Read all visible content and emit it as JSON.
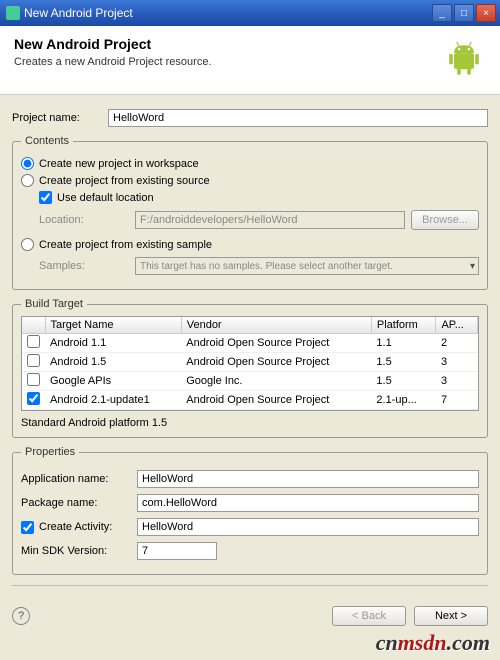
{
  "window": {
    "title": "New Android Project"
  },
  "header": {
    "title": "New Android Project",
    "subtitle": "Creates a new Android Project resource."
  },
  "projectName": {
    "label": "Project name:",
    "value": "HelloWord"
  },
  "contents": {
    "legend": "Contents",
    "createNew": "Create new project in workspace",
    "fromSource": "Create project from existing source",
    "useDefault": "Use default location",
    "locationLabel": "Location:",
    "locationValue": "F:/androiddevelopers/HelloWord",
    "browse": "Browse...",
    "fromSample": "Create project from existing sample",
    "samplesLabel": "Samples:",
    "samplesPlaceholder": "This target has no samples. Please select another target."
  },
  "buildTarget": {
    "legend": "Build Target",
    "cols": {
      "name": "Target Name",
      "vendor": "Vendor",
      "platform": "Platform",
      "api": "AP..."
    },
    "rows": [
      {
        "checked": false,
        "name": "Android 1.1",
        "vendor": "Android Open Source Project",
        "platform": "1.1",
        "api": "2"
      },
      {
        "checked": false,
        "name": "Android 1.5",
        "vendor": "Android Open Source Project",
        "platform": "1.5",
        "api": "3"
      },
      {
        "checked": false,
        "name": "Google APIs",
        "vendor": "Google Inc.",
        "platform": "1.5",
        "api": "3"
      },
      {
        "checked": true,
        "name": "Android 2.1-update1",
        "vendor": "Android Open Source Project",
        "platform": "2.1-up...",
        "api": "7"
      }
    ],
    "note": "Standard Android platform 1.5"
  },
  "properties": {
    "legend": "Properties",
    "appNameLabel": "Application name:",
    "appNameValue": "HelloWord",
    "pkgLabel": "Package name:",
    "pkgValue": "com.HelloWord",
    "activityLabel": "Create Activity:",
    "activityValue": "HelloWord",
    "minSdkLabel": "Min SDK Version:",
    "minSdkValue": "7"
  },
  "footer": {
    "back": "< Back",
    "next": "Next >"
  },
  "watermark": {
    "a": "cn",
    "b": "msdn",
    "c": ".com"
  }
}
